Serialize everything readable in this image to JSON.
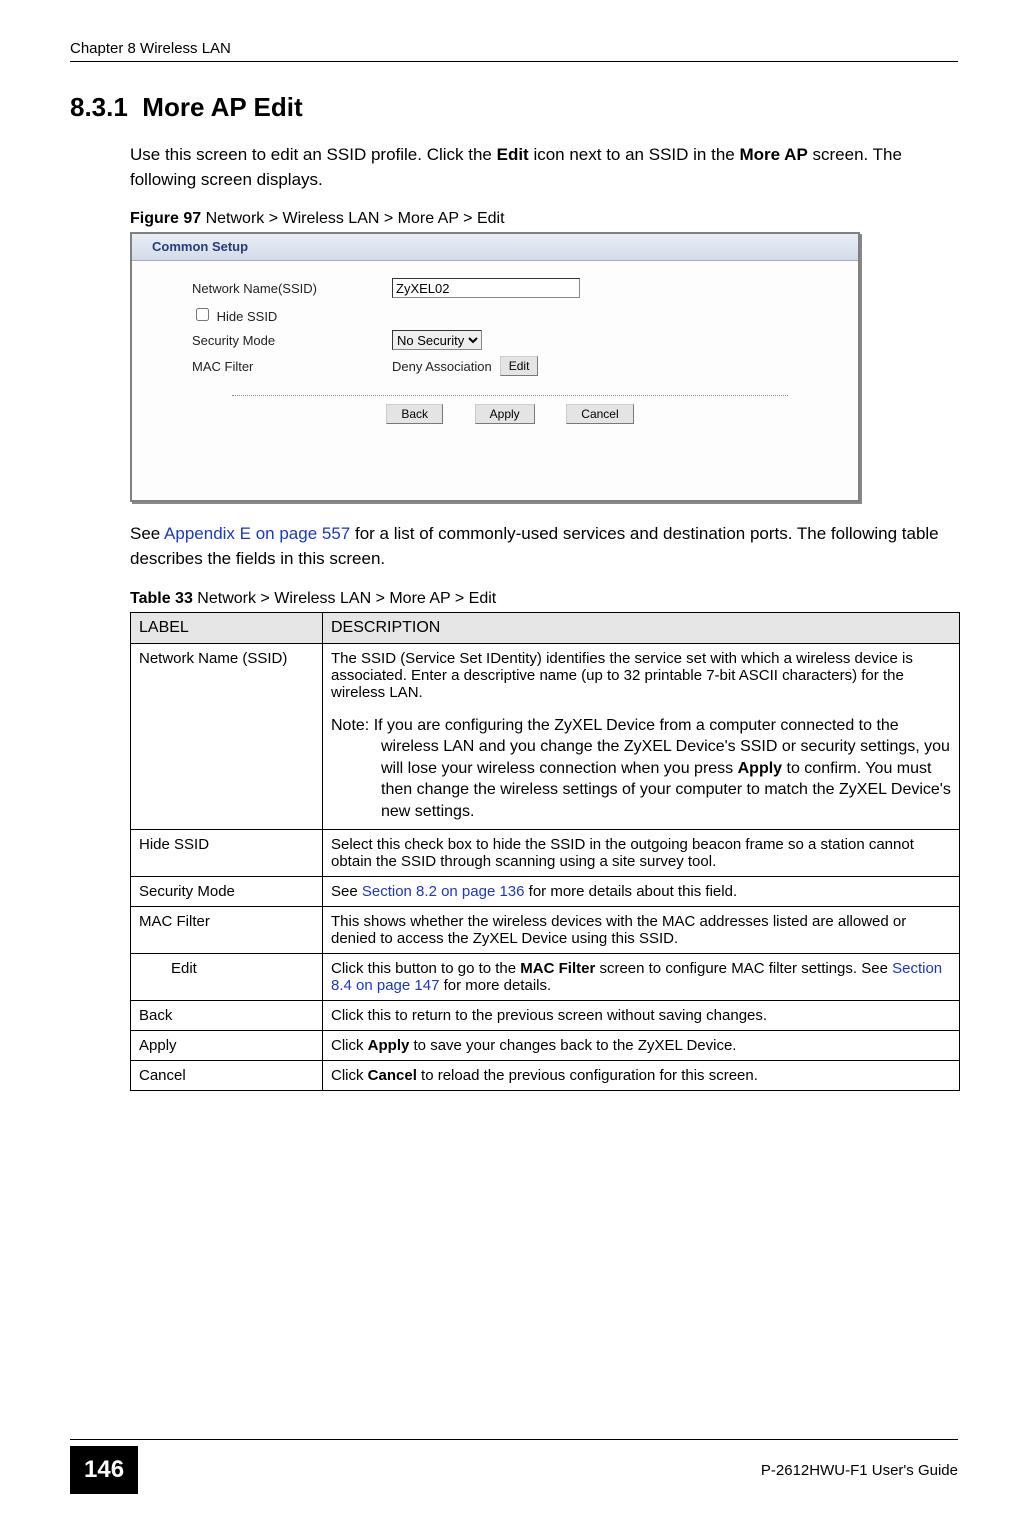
{
  "header": {
    "left": "Chapter 8 Wireless LAN"
  },
  "section": {
    "number": "8.3.1",
    "title": "More AP Edit"
  },
  "para1": {
    "pre": "Use this screen to edit an SSID profile. Click the ",
    "edit": "Edit",
    "mid": " icon next to an SSID in the ",
    "moreap": "More AP",
    "post": " screen. The following screen displays."
  },
  "figure": {
    "label": "Figure 97",
    "sep": "   ",
    "caption": "Network > Wireless LAN > More AP > Edit"
  },
  "screenshot": {
    "bar": "Common Setup",
    "rows": {
      "ssid_label": "Network Name(SSID)",
      "ssid_value": "ZyXEL02",
      "hide_label": "Hide SSID",
      "sec_label": "Security Mode",
      "sec_value": "No Security",
      "mac_label": "MAC Filter",
      "deny_text": "Deny Association",
      "edit_btn": "Edit"
    },
    "buttons": {
      "back": "Back",
      "apply": "Apply",
      "cancel": "Cancel"
    }
  },
  "para2": {
    "pre": "See ",
    "link": "Appendix E on page 557",
    "post": " for a list of commonly-used services and destination ports. The following table describes the fields in this screen."
  },
  "table": {
    "label": "Table 33",
    "sep": "   ",
    "caption": "Network > Wireless LAN > More AP > Edit",
    "head": {
      "c1": "LABEL",
      "c2": "DESCRIPTION"
    },
    "rows": [
      {
        "label": "Network Name (SSID)",
        "desc": "The SSID (Service Set IDentity) identifies the service set with which a wireless device is associated. Enter a descriptive name (up to 32 printable 7-bit ASCII characters) for the wireless LAN.",
        "note_pre": "Note: If you are configuring the ZyXEL Device from a computer connected to the wireless LAN and you change the ZyXEL Device's SSID or security settings, you will lose your wireless connection when you press ",
        "note_apply": "Apply",
        "note_post": " to confirm. You must then change the wireless settings of your computer to match the ZyXEL Device's new settings."
      },
      {
        "label": "Hide SSID",
        "desc": "Select this check box to hide the SSID in the outgoing beacon frame so a station cannot obtain the SSID through scanning using a site survey tool."
      },
      {
        "label": "Security Mode",
        "desc_pre": "See ",
        "desc_link": "Section 8.2 on page 136",
        "desc_post": " for more details about this field."
      },
      {
        "label": "MAC Filter",
        "desc": "This shows whether the wireless devices with the MAC addresses listed are allowed or denied to access the ZyXEL Device using this SSID."
      },
      {
        "label": "Edit",
        "indent": true,
        "desc_pre": "Click this button to go to the ",
        "desc_bold": "MAC Filter",
        "desc_mid": " screen to configure MAC filter settings. See ",
        "desc_link": "Section 8.4 on page 147",
        "desc_post": " for more details."
      },
      {
        "label": "Back",
        "desc": "Click this to return to the previous screen without saving changes."
      },
      {
        "label": "Apply",
        "desc_pre": "Click ",
        "desc_bold": "Apply",
        "desc_post": " to save your changes back to the ZyXEL Device."
      },
      {
        "label": "Cancel",
        "desc_pre": "Click ",
        "desc_bold": "Cancel",
        "desc_post": " to reload the previous configuration for this screen."
      }
    ]
  },
  "footer": {
    "page": "146",
    "guide": "P-2612HWU-F1 User's Guide"
  }
}
